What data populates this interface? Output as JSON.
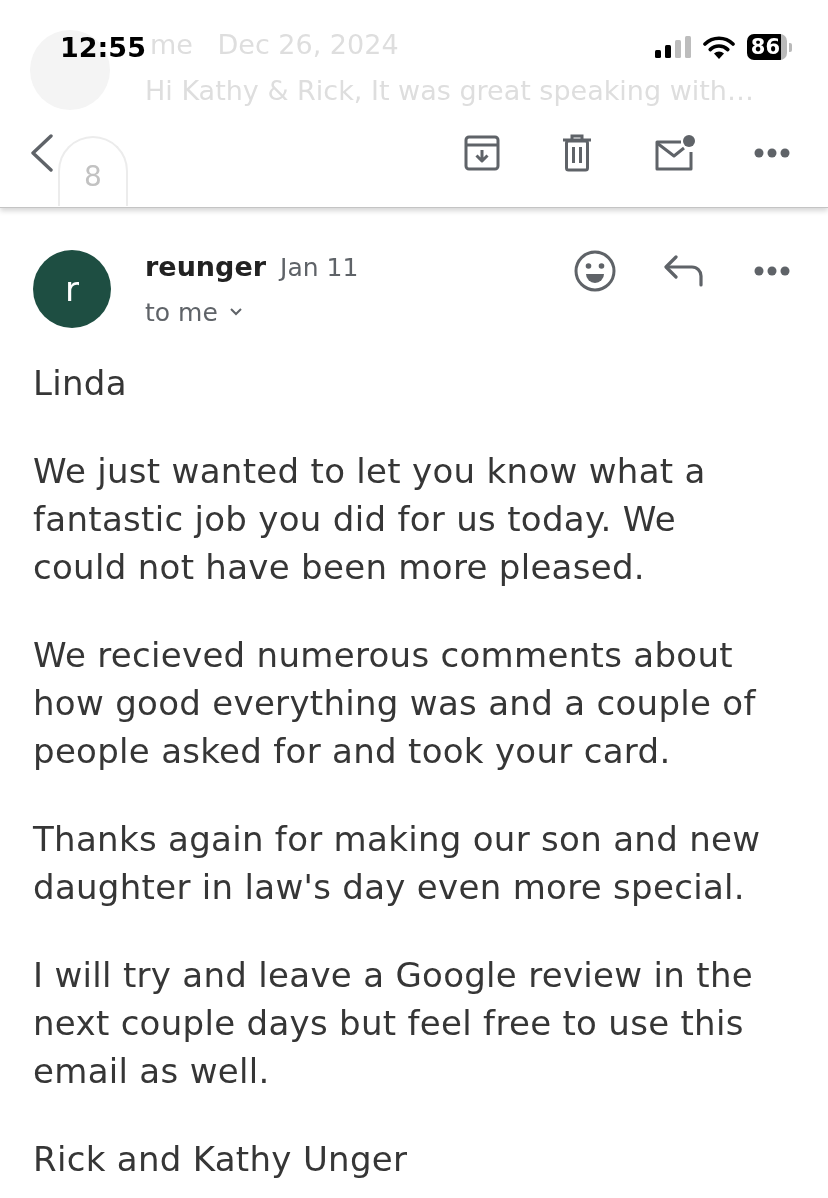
{
  "status_bar": {
    "time": "12:55",
    "battery": "86"
  },
  "previous_message": {
    "sender": "me",
    "date": "Dec 26, 2024",
    "snippet": "Hi Kathy & Rick, It was great speaking with…",
    "hidden_count": "8"
  },
  "message": {
    "avatar_letter": "r",
    "sender": "reunger",
    "date": "Jan 11",
    "recipient": "to me",
    "body": [
      "Linda",
      "We just wanted to let you know what a fantastic job you did for us today. We could not have been more pleased.",
      "We recieved numerous comments about how good everything was and a couple of people asked for and took your card.",
      "Thanks again for making our son and new daughter in law's day even more special.",
      "I will try and leave a Google review in the next couple days but feel free to use this email as well.",
      "Rick and Kathy Unger"
    ]
  }
}
